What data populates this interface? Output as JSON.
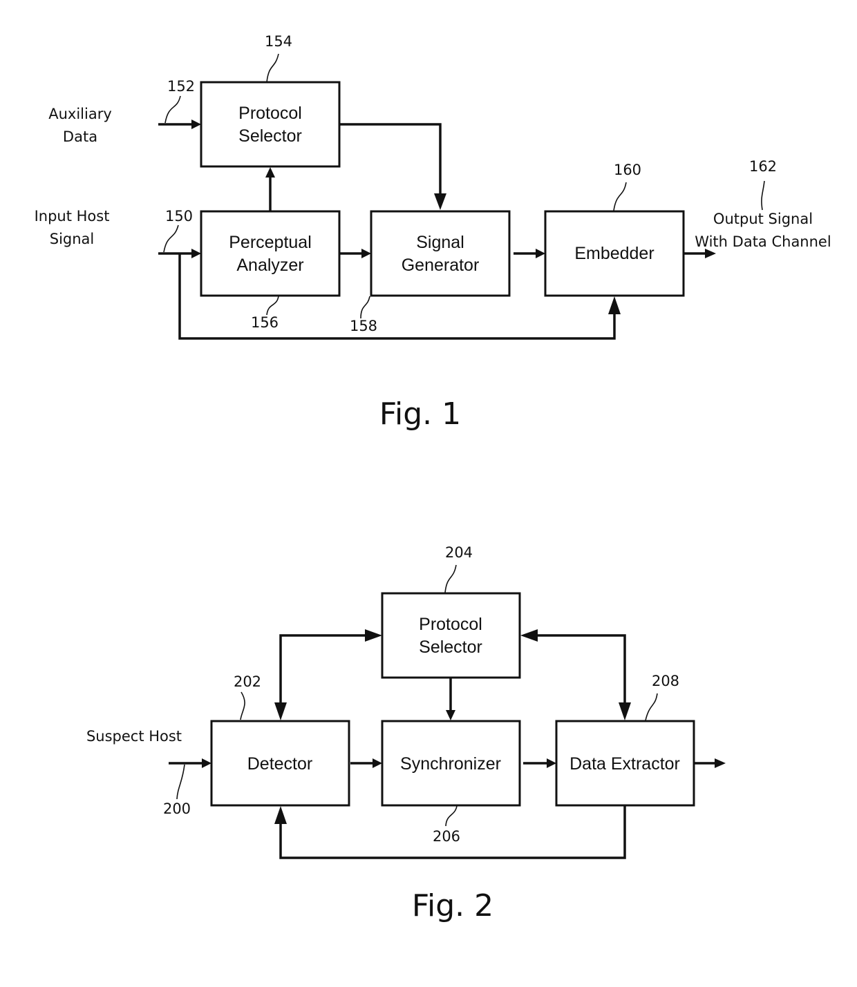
{
  "figure1": {
    "caption": "Fig. 1",
    "inputs": {
      "auxiliary_data": [
        "Auxiliary",
        "Data"
      ],
      "input_host_signal": [
        "Input Host",
        "Signal"
      ]
    },
    "output": [
      "Output Signal",
      "With Data Channel"
    ],
    "blocks": {
      "protocol_selector": [
        "Protocol",
        "Selector"
      ],
      "perceptual_analyzer": [
        "Perceptual",
        "Analyzer"
      ],
      "signal_generator": [
        "Signal",
        "Generator"
      ],
      "embedder": [
        "Embedder"
      ]
    },
    "refs": {
      "input_host_signal": "150",
      "auxiliary_data": "152",
      "protocol_selector": "154",
      "perceptual_analyzer": "156",
      "signal_generator": "158",
      "embedder": "160",
      "output_signal": "162"
    },
    "connections": [
      {
        "from": "auxiliary_data",
        "to": "protocol_selector"
      },
      {
        "from": "input_host_signal",
        "to": "perceptual_analyzer"
      },
      {
        "from": "perceptual_analyzer",
        "to": "protocol_selector"
      },
      {
        "from": "protocol_selector",
        "to": "signal_generator"
      },
      {
        "from": "perceptual_analyzer",
        "to": "signal_generator"
      },
      {
        "from": "signal_generator",
        "to": "embedder"
      },
      {
        "from": "input_host_signal",
        "to": "embedder"
      },
      {
        "from": "embedder",
        "to": "output_signal"
      }
    ]
  },
  "figure2": {
    "caption": "Fig. 2",
    "inputs": {
      "suspect_host": "Suspect Host"
    },
    "blocks": {
      "protocol_selector": [
        "Protocol",
        "Selector"
      ],
      "detector": [
        "Detector"
      ],
      "synchronizer": [
        "Synchronizer"
      ],
      "data_extractor": [
        "Data Extractor"
      ]
    },
    "refs": {
      "suspect_host": "200",
      "detector": "202",
      "protocol_selector": "204",
      "synchronizer": "206",
      "data_extractor": "208"
    },
    "connections": [
      {
        "from": "suspect_host",
        "to": "detector"
      },
      {
        "from": "detector",
        "to": "protocol_selector",
        "bidirectional": true
      },
      {
        "from": "protocol_selector",
        "to": "synchronizer"
      },
      {
        "from": "detector",
        "to": "synchronizer"
      },
      {
        "from": "synchronizer",
        "to": "data_extractor"
      },
      {
        "from": "data_extractor",
        "to": "protocol_selector",
        "bidirectional": true
      },
      {
        "from": "data_extractor",
        "to": "detector"
      },
      {
        "from": "data_extractor",
        "to": "output"
      }
    ]
  }
}
